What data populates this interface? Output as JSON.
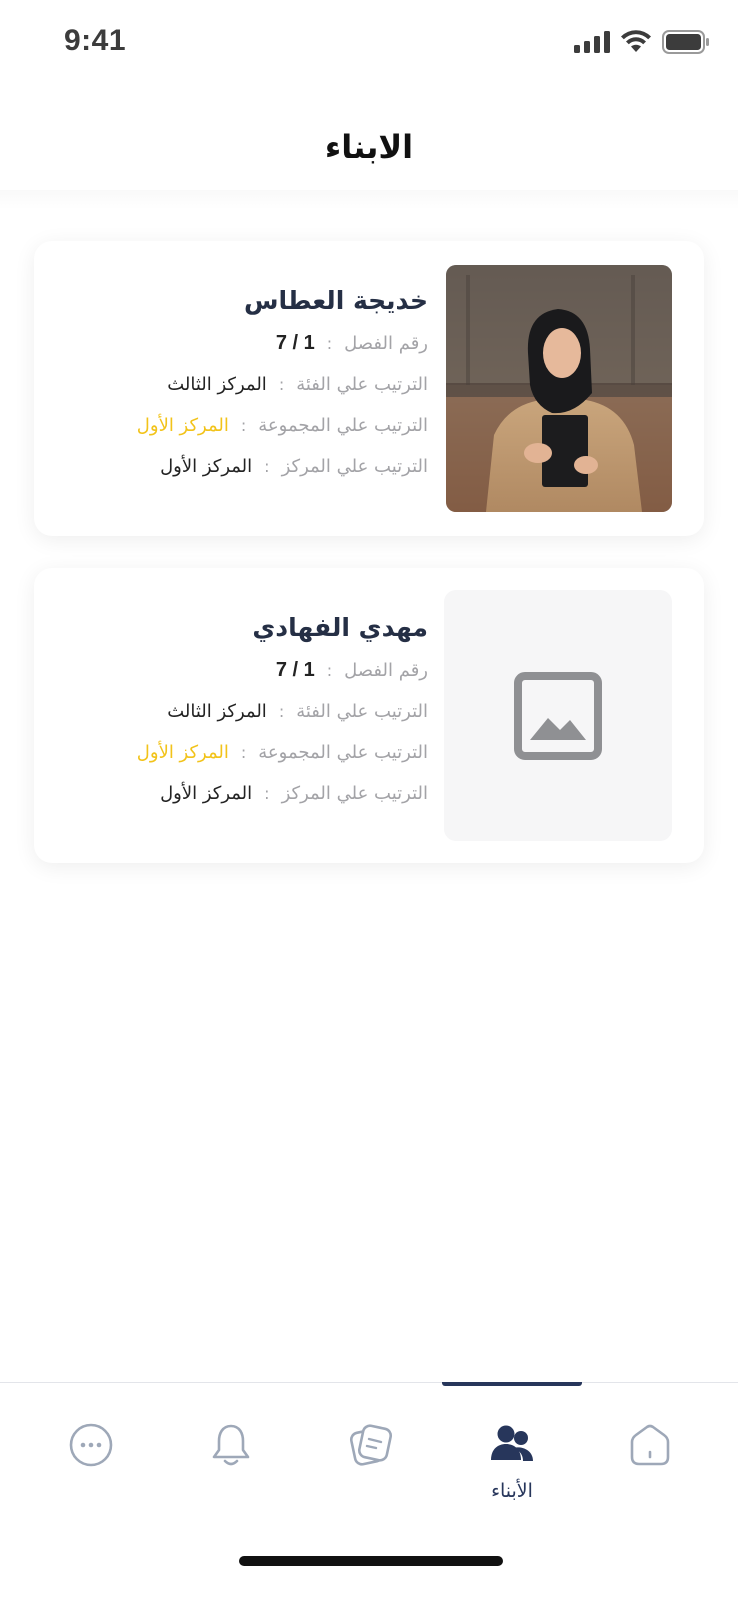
{
  "status_bar": {
    "time": "9:41"
  },
  "header": {
    "title": "الابناء"
  },
  "labels": {
    "class_number": "رقم الفصل",
    "category_rank": "الترتيب علي الفئة",
    "group_rank": "الترتيب علي المجموعة",
    "center_rank": "الترتيب علي المركز",
    "separator": ":"
  },
  "children": [
    {
      "name": "خديجة العطاس",
      "class_number": "7 / 1",
      "category_rank": "المركز الثالث",
      "group_rank": "المركز الأول",
      "center_rank": "المركز الأول",
      "has_photo": true
    },
    {
      "name": "مهدي الفهادي",
      "class_number": "7 / 1",
      "category_rank": "المركز الثالث",
      "group_rank": "المركز الأول",
      "center_rank": "المركز الأول",
      "has_photo": false
    }
  ],
  "bottom_nav": {
    "items": [
      {
        "icon": "more-icon",
        "label": ""
      },
      {
        "icon": "bell-icon",
        "label": ""
      },
      {
        "icon": "notes-icon",
        "label": ""
      },
      {
        "icon": "users-icon",
        "label": "الأبناء",
        "active": true
      },
      {
        "icon": "home-icon",
        "label": ""
      }
    ]
  },
  "colors": {
    "primary": "#27365b",
    "highlight": "#f2c31a",
    "muted": "#a3a3a7",
    "icon_inactive": "#9ea8b8"
  }
}
